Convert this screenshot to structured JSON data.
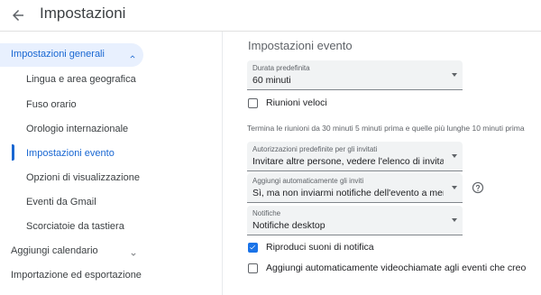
{
  "header": {
    "title": "Impostazioni"
  },
  "sidebar": {
    "general": {
      "label": "Impostazioni generali"
    },
    "sub_items": [
      {
        "label": "Lingua e area geografica"
      },
      {
        "label": "Fuso orario"
      },
      {
        "label": "Orologio internazionale"
      },
      {
        "label": "Impostazioni evento"
      },
      {
        "label": "Opzioni di visualizzazione"
      },
      {
        "label": "Eventi da Gmail"
      },
      {
        "label": "Scorciatoie da tastiera"
      }
    ],
    "add_calendar": {
      "label": "Aggiungi calendario"
    },
    "import_export": {
      "label": "Importazione ed esportazione"
    }
  },
  "main": {
    "section_title": "Impostazioni evento",
    "default_duration": {
      "caption": "Durata predefinita",
      "value": "60 minuti"
    },
    "speedy_meetings": {
      "label": "Riunioni veloci",
      "checked": false
    },
    "speedy_hint": "Termina le riunioni da 30 minuti 5 minuti prima e quelle più lunghe 10 minuti prima",
    "guest_permissions": {
      "caption": "Autorizzazioni predefinite per gli invitati",
      "value": "Invitare altre persone, vedere l'elenco di invitati"
    },
    "auto_add_invites": {
      "caption": "Aggiungi automaticamente gli inviti",
      "value": "Sì, ma non inviarmi notifiche dell'evento a meno c..."
    },
    "notifications": {
      "caption": "Notifiche",
      "value": "Notifiche desktop"
    },
    "play_sounds": {
      "label": "Riproduci suoni di notifica",
      "checked": true
    },
    "auto_video": {
      "label": "Aggiungi automaticamente videochiamate agli eventi che creo",
      "checked": false
    }
  },
  "colors": {
    "accent": "#1a73e8",
    "nav_active_bg": "#e8f0fe",
    "nav_active_text": "#1967d2"
  }
}
